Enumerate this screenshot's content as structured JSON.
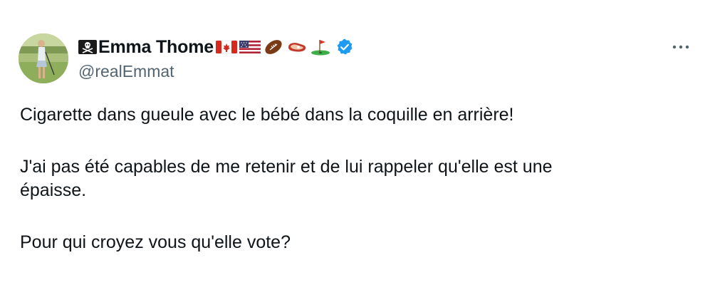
{
  "author": {
    "display_name": "Emma Thome",
    "handle": "@realEmmat",
    "name_prefix_icon": "skull-crossbones-flag-icon",
    "name_emojis": [
      "canada-flag-icon",
      "usa-flag-icon",
      "american-football-icon",
      "steak-icon",
      "golf-flag-icon"
    ],
    "verified": true,
    "verified_color": "#1d9bf0"
  },
  "tweet": {
    "line1": "Cigarette dans gueule  avec le bébé dans la coquille en arrière!",
    "line2": "J'ai pas été capables de me retenir et de lui rappeler qu'elle est une",
    "line3": "épaisse.",
    "line4": "Pour qui croyez vous qu'elle vote?"
  },
  "menu": {
    "icon": "more-horizontal-icon"
  },
  "colors": {
    "text": "#0f1419",
    "secondary": "#536471",
    "accent": "#1d9bf0"
  }
}
